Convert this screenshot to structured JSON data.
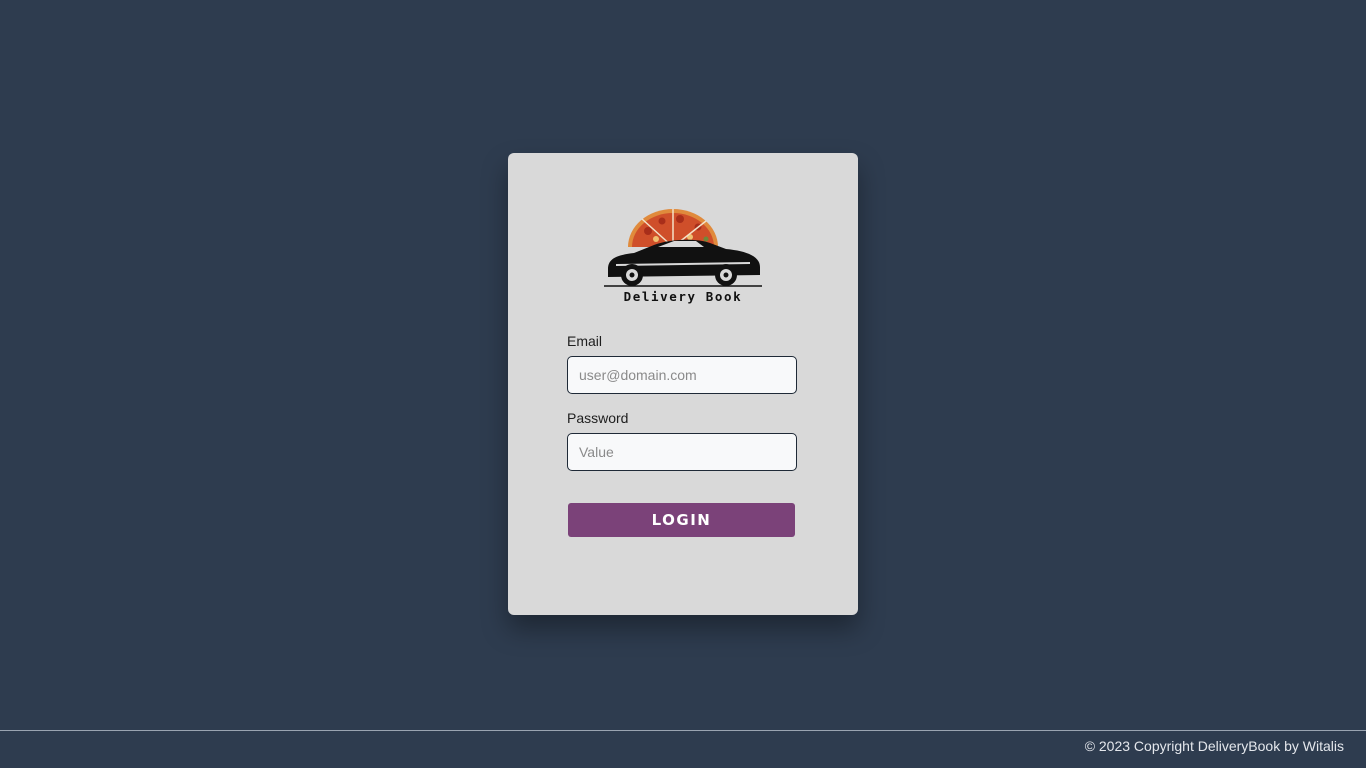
{
  "login": {
    "logo_text": "Delivery Book",
    "email_label": "Email",
    "email_placeholder": "user@domain.com",
    "email_value": "",
    "password_label": "Password",
    "password_placeholder": "Value",
    "password_value": "",
    "login_label": "LOGIN"
  },
  "footer": {
    "copyright": "© 2023 Copyright DeliveryBook by Witalis"
  },
  "colors": {
    "background": "#2e3c4f",
    "card": "#d9d9d9",
    "button": "#7b4279"
  },
  "icons": {
    "logo": "pizza-delivery-car-logo"
  }
}
